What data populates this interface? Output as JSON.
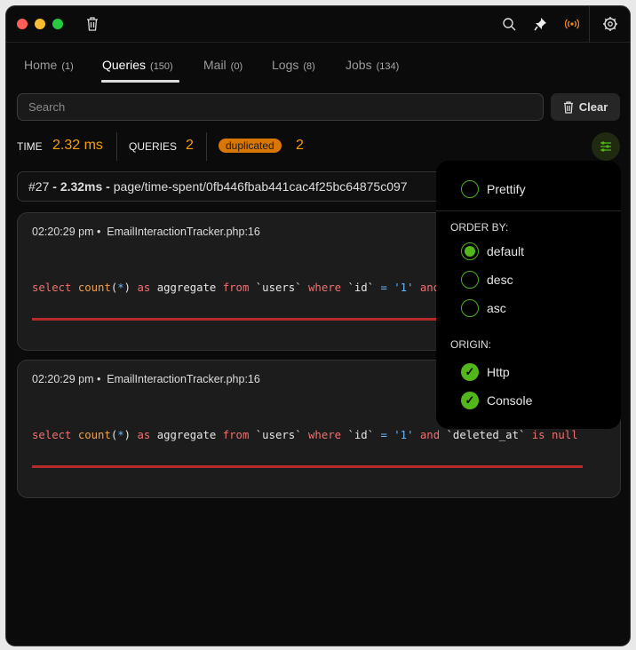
{
  "window": {
    "traffic_colors": [
      "#ff5f57",
      "#febc2e",
      "#28c840"
    ],
    "accent": "#52b71a",
    "warning": "#f59e0b"
  },
  "tabs": [
    {
      "label": "Home",
      "count": "(1)"
    },
    {
      "label": "Queries",
      "count": "(150)",
      "active": true
    },
    {
      "label": "Mail",
      "count": "(0)"
    },
    {
      "label": "Logs",
      "count": "(8)"
    },
    {
      "label": "Jobs",
      "count": "(134)"
    }
  ],
  "search": {
    "placeholder": "Search",
    "value": ""
  },
  "clear_label": "Clear",
  "stats": {
    "time_label": "TIME",
    "time_value": "2.32 ms",
    "queries_label": "QUERIES",
    "queries_value": "2",
    "duplicated_label": "duplicated",
    "duplicated_value": "2"
  },
  "request": {
    "id": "#27",
    "sep1": " - ",
    "duration": "2.32ms",
    "sep2": " - ",
    "path": "page/time-spent/0fb446fbab441cac4f25bc64875c097"
  },
  "queries": [
    {
      "time": "02:20:29 pm",
      "file": "EmailInteractionTracker.php:16"
    },
    {
      "time": "02:20:29 pm",
      "file": "EmailInteractionTracker.php:16"
    }
  ],
  "sql_tokens": [
    {
      "t": "select ",
      "c": "k"
    },
    {
      "t": "count",
      "c": "f"
    },
    {
      "t": "(",
      "c": "w"
    },
    {
      "t": "*",
      "c": "b"
    },
    {
      "t": ") ",
      "c": "w"
    },
    {
      "t": "as ",
      "c": "k"
    },
    {
      "t": "aggregate ",
      "c": "w"
    },
    {
      "t": "from ",
      "c": "k"
    },
    {
      "t": "`users` ",
      "c": "w"
    },
    {
      "t": "where ",
      "c": "k"
    },
    {
      "t": "`id` ",
      "c": "w"
    },
    {
      "t": "= ",
      "c": "b"
    },
    {
      "t": "'1' ",
      "c": "b"
    },
    {
      "t": "and ",
      "c": "k"
    },
    {
      "t": "`deleted_at` ",
      "c": "w"
    },
    {
      "t": "is ",
      "c": "k"
    },
    {
      "t": "null",
      "c": "k"
    }
  ],
  "popup": {
    "prettify": {
      "label": "Prettify",
      "checked": false
    },
    "order_label": "ORDER BY:",
    "order": [
      {
        "label": "default",
        "selected": true
      },
      {
        "label": "desc",
        "selected": false
      },
      {
        "label": "asc",
        "selected": false
      }
    ],
    "origin_label": "ORIGIN:",
    "origin": [
      {
        "label": "Http",
        "checked": true
      },
      {
        "label": "Console",
        "checked": true
      }
    ]
  }
}
